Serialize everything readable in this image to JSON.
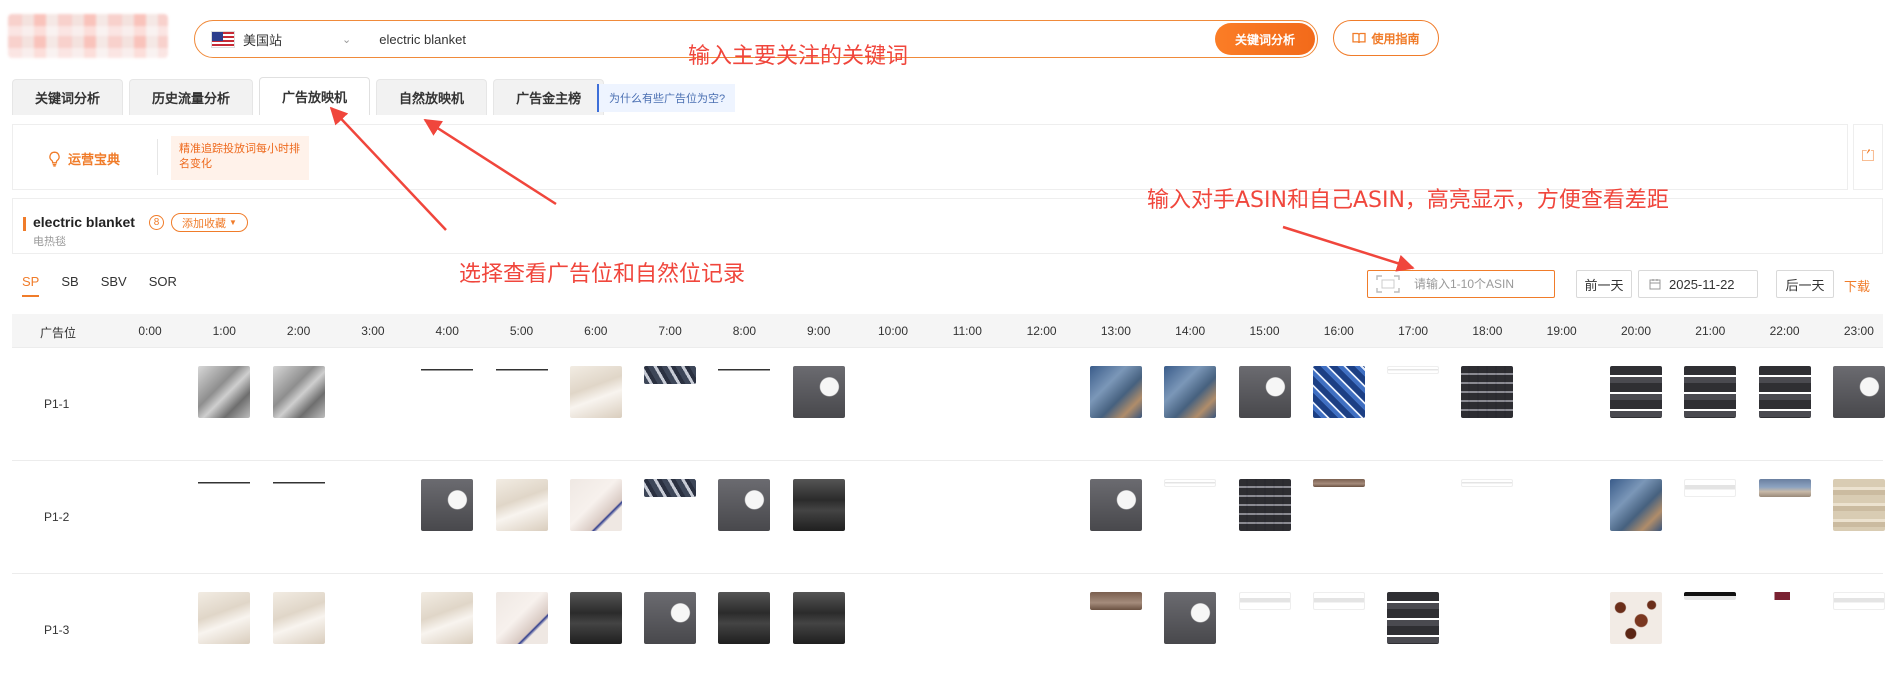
{
  "header": {
    "station": "美国站",
    "keyword_value": "electric blanket",
    "analyze_button": "关键词分析",
    "guide_button": "使用指南"
  },
  "annotations": {
    "keyword_hint": "输入主要关注的关键词",
    "asin_hint": "输入对手ASIN和自己ASIN，高亮显示，方便查看差距",
    "tab_hint": "选择查看广告位和自然位记录"
  },
  "tabs": [
    {
      "label": "关键词分析",
      "active": false
    },
    {
      "label": "历史流量分析",
      "active": false
    },
    {
      "label": "广告放映机",
      "active": true
    },
    {
      "label": "自然放映机",
      "active": false
    },
    {
      "label": "广告金主榜",
      "active": false
    }
  ],
  "tab_tip": "为什么有些广告位为空?",
  "tip_panel": {
    "label": "运营宝典",
    "note": "精准追踪投放词每小时排名变化"
  },
  "keyword_panel": {
    "title": "electric blanket",
    "badge": "8",
    "fav_button": "添加收藏",
    "subtitle": "电热毯"
  },
  "ad_types": [
    {
      "label": "SP",
      "active": true
    },
    {
      "label": "SB",
      "active": false
    },
    {
      "label": "SBV",
      "active": false
    },
    {
      "label": "SOR",
      "active": false
    }
  ],
  "controls": {
    "asin_placeholder": "请输入1-10个ASIN",
    "prev_day": "前一天",
    "date": "2025-11-22",
    "next_day": "后一天",
    "download": "下载"
  },
  "grid": {
    "position_header": "广告位",
    "hours": [
      "0:00",
      "1:00",
      "2:00",
      "3:00",
      "4:00",
      "5:00",
      "6:00",
      "7:00",
      "8:00",
      "9:00",
      "10:00",
      "11:00",
      "12:00",
      "13:00",
      "14:00",
      "15:00",
      "16:00",
      "17:00",
      "18:00",
      "19:00",
      "20:00",
      "21:00",
      "22:00",
      "23:00"
    ],
    "rows": [
      {
        "label": "P1-1",
        "cells": [
          "",
          "grey",
          "grey",
          "",
          "tent",
          "tent",
          "cream",
          "striped",
          "tent",
          "ctrl",
          "",
          "",
          "",
          "blue",
          "blue",
          "ctrl",
          "navy",
          "wm",
          "plaid",
          "",
          "stack",
          "stack",
          "stack",
          "ctrl"
        ]
      },
      {
        "label": "P1-2",
        "cells": [
          "",
          "tent",
          "tent",
          "",
          "ctrl",
          "cream",
          "pink",
          "striped",
          "ctrl",
          "dark",
          "",
          "",
          "",
          "ctrl",
          "wm",
          "plaid",
          "brown",
          "",
          "wm",
          "",
          "blue",
          "wm",
          "room",
          "beige"
        ]
      },
      {
        "label": "P1-3",
        "cells": [
          "",
          "cream",
          "cream",
          "",
          "cream",
          "pink",
          "dark",
          "ctrl",
          "dark",
          "dark",
          "",
          "",
          "",
          "brown",
          "ctrl",
          "wm",
          "wm",
          "stack",
          "",
          "",
          "cheetah",
          "blackstrip",
          "maroon",
          "wm"
        ]
      }
    ]
  },
  "colors": {
    "accent": "#f07c2a",
    "annotation": "#f0463c",
    "tip_blue": "#3e6fd8"
  }
}
